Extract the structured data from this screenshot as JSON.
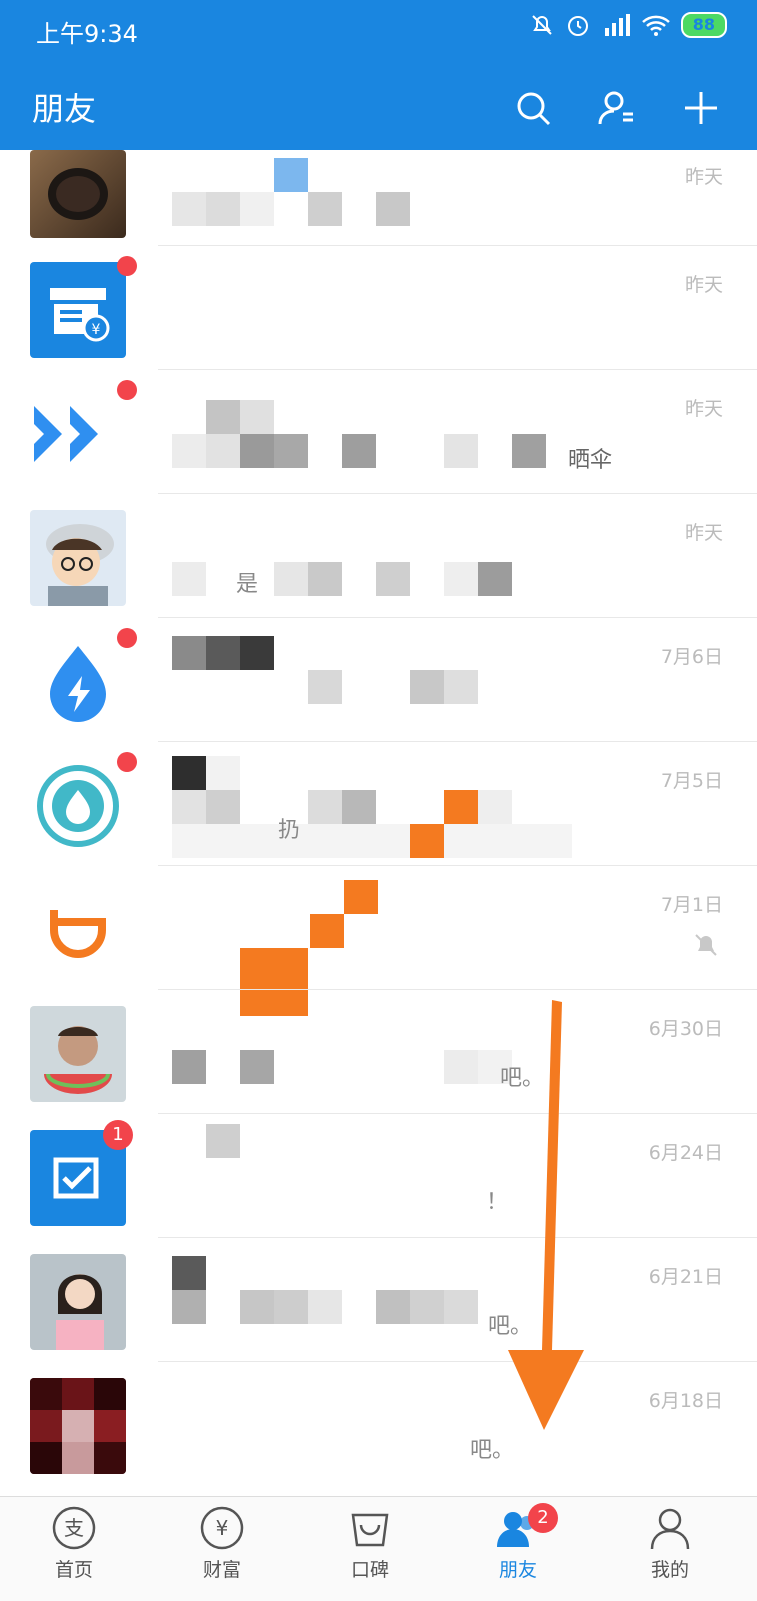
{
  "status": {
    "time": "上午9:34",
    "battery": "88"
  },
  "header": {
    "title": "朋友"
  },
  "conversations": [
    {
      "time": "昨天",
      "preview": ""
    },
    {
      "time": "昨天",
      "preview": ""
    },
    {
      "time": "昨天",
      "preview": "晒伞"
    },
    {
      "time": "昨天",
      "preview": "是"
    },
    {
      "time": "7月6日",
      "preview": ""
    },
    {
      "time": "7月5日",
      "preview": "扔"
    },
    {
      "time": "7月1日",
      "preview": ""
    },
    {
      "time": "6月30日",
      "preview": "吧。"
    },
    {
      "time": "6月24日",
      "preview": "！",
      "badge": "1"
    },
    {
      "time": "6月21日",
      "preview": "吧。"
    },
    {
      "time": "6月18日",
      "preview": "吧。"
    }
  ],
  "tabs": [
    {
      "label": "首页"
    },
    {
      "label": "财富"
    },
    {
      "label": "口碑"
    },
    {
      "label": "朋友",
      "badge": "2"
    },
    {
      "label": "我的"
    }
  ],
  "colors": {
    "brand": "#1a86e0",
    "badge": "#f2444b",
    "arrow": "#f47a20"
  }
}
